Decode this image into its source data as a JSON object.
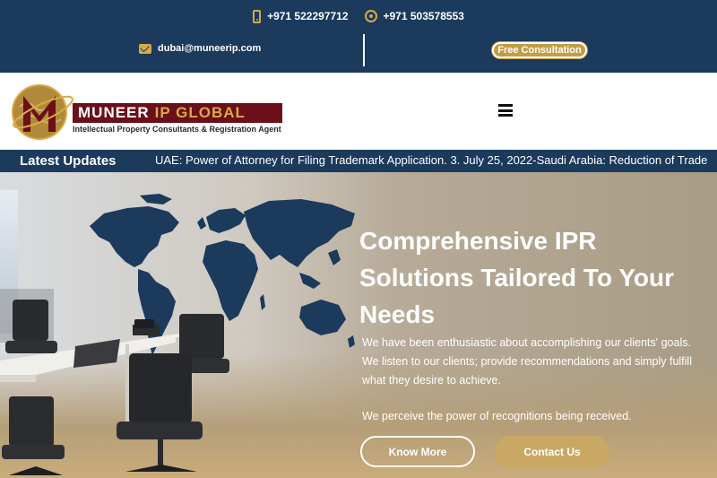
{
  "topbar": {
    "phone": "+971 522297712",
    "whatsapp": "+971 503578553",
    "email": "dubai@muneerip.com",
    "consult_label": "Free Consultation",
    "phone_icon": "phone-icon",
    "whatsapp_icon": "whatsapp-icon",
    "email_icon": "envelope-icon"
  },
  "header": {
    "logo": {
      "name_part1": "MUNEER",
      "name_part2": "IP GLOBAL",
      "tagline": "Intellectual Property Consultants & Registration Agent"
    },
    "menu_icon": "hamburger-menu-icon"
  },
  "ticker": {
    "label": "Latest Updates",
    "text": "UAE: Power of Attorney for Filing Trademark Application.   3. July 25, 2022-Saudi Arabia: Reduction of Trade"
  },
  "hero": {
    "title": "Comprehensive IPR Solutions Tailored To Your Needs",
    "paragraph1": "We have been enthusiastic about accomplishing our clients' goals. We listen to our clients; provide recommendations and simply fulfill what they desire to achieve.",
    "paragraph2": "We perceive the power of recognitions being received.",
    "know_more_label": "Know More",
    "contact_label": "Contact Us"
  },
  "colors": {
    "navy": "#1b3a5c",
    "gold": "#d8aa45",
    "maroon": "#6b0f1a",
    "button_gold": "#c9a864"
  }
}
